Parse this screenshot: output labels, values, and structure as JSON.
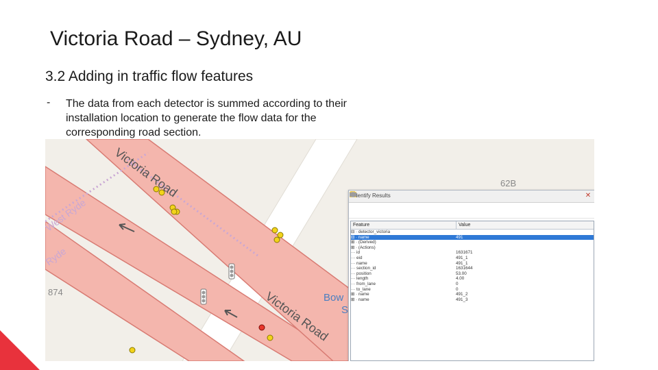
{
  "slide": {
    "title": "Victoria Road – Sydney, AU",
    "section_heading": "3.2 Adding in traffic flow features",
    "bullet_marker": "-",
    "bullet_lines": [
      "The data from each detector is summed according to their",
      "installation location to generate the flow data for the",
      "corresponding road section."
    ]
  },
  "map": {
    "road_label_top": "Victoria Road",
    "road_label_bottom": "Victoria Road",
    "suburb_label_1": "West Ryde",
    "suburb_label_2": "Ryde",
    "house_number_1": "874",
    "house_number_2": "62B",
    "place_label_1": "Bow",
    "place_label_2": "S",
    "colors": {
      "road_fill": "#f4b6ad",
      "road_edge": "#d87b73",
      "background": "#f2efe9",
      "side_road": "#ffffff",
      "dot_path": "#c9a7d4",
      "detector_yellow": "#f2d31b",
      "detector_red": "#e8372c"
    }
  },
  "identify_panel": {
    "title": "Identify Results",
    "columns": [
      "Feature",
      "Value"
    ],
    "rows": [
      {
        "feature": "⊟ · detector_victoria",
        "value": ""
      },
      {
        "feature": "   ⊟ · name",
        "value": "491",
        "selected": true
      },
      {
        "feature": "      ⊞ · (Derived)",
        "value": ""
      },
      {
        "feature": "      ⊞ · (Actions)",
        "value": ""
      },
      {
        "feature": "         ··· id",
        "value": "1631671"
      },
      {
        "feature": "         ··· eid",
        "value": "491_1"
      },
      {
        "feature": "         ··· name",
        "value": "491_1"
      },
      {
        "feature": "         ··· section_id",
        "value": "1631644"
      },
      {
        "feature": "         ··· position",
        "value": "53.00"
      },
      {
        "feature": "         ··· length",
        "value": "4.00"
      },
      {
        "feature": "         ··· from_lane",
        "value": "0"
      },
      {
        "feature": "         ··· to_lane",
        "value": "0"
      },
      {
        "feature": "   ⊞ · name",
        "value": "491_2"
      },
      {
        "feature": "   ⊞ · name",
        "value": "491_3"
      }
    ],
    "toolbar_icons": [
      "expand-tree-icon",
      "collapse-tree-icon",
      "expand-new-icon",
      "deselect-icon",
      "copy-icon",
      "settings-icon",
      "print-icon"
    ]
  }
}
